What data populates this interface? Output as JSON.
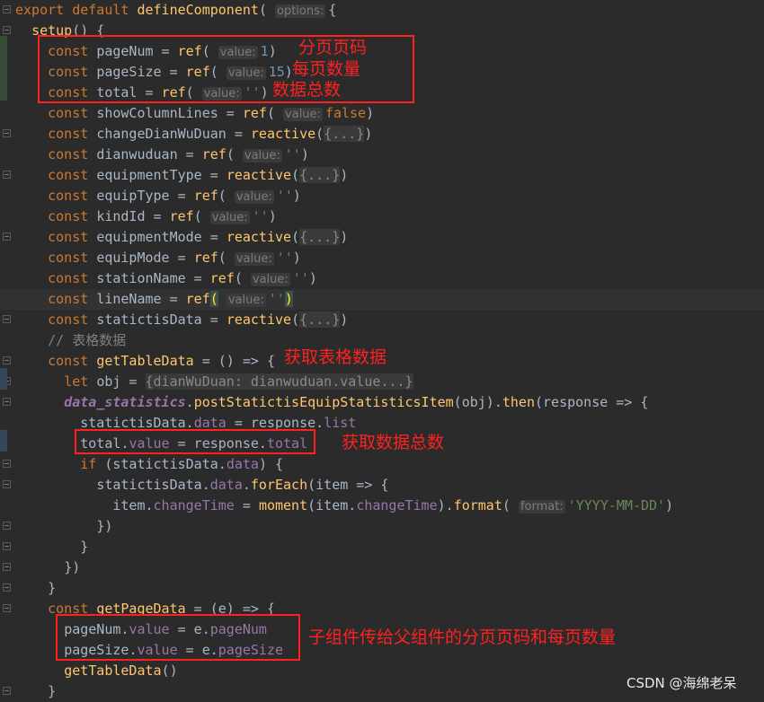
{
  "editor": {
    "lines": [
      {
        "indent": 0,
        "fold": true,
        "tokens": [
          [
            "k",
            "export default "
          ],
          [
            "f",
            "defineComponent"
          ],
          [
            "p",
            "( "
          ],
          [
            "h",
            "options:"
          ],
          [
            "p",
            "{"
          ]
        ]
      },
      {
        "indent": 1,
        "fold": true,
        "tokens": [
          [
            "f",
            "setup"
          ],
          [
            "p",
            "() {"
          ]
        ]
      },
      {
        "indent": 2,
        "tokens": [
          [
            "k",
            "const "
          ],
          [
            "p",
            "pageNum = "
          ],
          [
            "f",
            "ref"
          ],
          [
            "p",
            "( "
          ],
          [
            "h",
            "value:"
          ],
          [
            "n",
            "1"
          ],
          [
            "p",
            ")"
          ]
        ]
      },
      {
        "indent": 2,
        "tokens": [
          [
            "k",
            "const "
          ],
          [
            "p",
            "pageSize = "
          ],
          [
            "f",
            "ref"
          ],
          [
            "p",
            "( "
          ],
          [
            "h",
            "value:"
          ],
          [
            "n",
            "15"
          ],
          [
            "p",
            ")"
          ]
        ]
      },
      {
        "indent": 2,
        "tokens": [
          [
            "k",
            "const "
          ],
          [
            "p",
            "total = "
          ],
          [
            "f",
            "ref"
          ],
          [
            "p",
            "( "
          ],
          [
            "h",
            "value:"
          ],
          [
            "s",
            "''"
          ],
          [
            "p",
            ")"
          ]
        ]
      },
      {
        "indent": 2,
        "tokens": [
          [
            "k",
            "const "
          ],
          [
            "p",
            "showColumnLines = "
          ],
          [
            "f",
            "ref"
          ],
          [
            "p",
            "( "
          ],
          [
            "h",
            "value:"
          ],
          [
            "k",
            "false"
          ],
          [
            "p",
            ")"
          ]
        ]
      },
      {
        "indent": 2,
        "fold": true,
        "tokens": [
          [
            "k",
            "const "
          ],
          [
            "p",
            "changeDianWuDuan = "
          ],
          [
            "f",
            "reactive"
          ],
          [
            "p",
            "("
          ],
          [
            "fd",
            "{...}"
          ],
          [
            "p",
            ")"
          ]
        ]
      },
      {
        "indent": 2,
        "tokens": [
          [
            "k",
            "const "
          ],
          [
            "p",
            "dianwuduan = "
          ],
          [
            "f",
            "ref"
          ],
          [
            "p",
            "( "
          ],
          [
            "h",
            "value:"
          ],
          [
            "s",
            "''"
          ],
          [
            "p",
            ")"
          ]
        ]
      },
      {
        "indent": 2,
        "fold": true,
        "tokens": [
          [
            "k",
            "const "
          ],
          [
            "p",
            "equipmentType = "
          ],
          [
            "f",
            "reactive"
          ],
          [
            "p",
            "("
          ],
          [
            "fd",
            "{...}"
          ],
          [
            "p",
            ")"
          ]
        ]
      },
      {
        "indent": 2,
        "tokens": [
          [
            "k",
            "const "
          ],
          [
            "p",
            "equipType = "
          ],
          [
            "f",
            "ref"
          ],
          [
            "p",
            "( "
          ],
          [
            "h",
            "value:"
          ],
          [
            "s",
            "''"
          ],
          [
            "p",
            ")"
          ]
        ]
      },
      {
        "indent": 2,
        "tokens": [
          [
            "k",
            "const "
          ],
          [
            "p",
            "kindId = "
          ],
          [
            "f",
            "ref"
          ],
          [
            "p",
            "( "
          ],
          [
            "h",
            "value:"
          ],
          [
            "s",
            "''"
          ],
          [
            "p",
            ")"
          ]
        ]
      },
      {
        "indent": 2,
        "fold": true,
        "tokens": [
          [
            "k",
            "const "
          ],
          [
            "p",
            "equipmentMode = "
          ],
          [
            "f",
            "reactive"
          ],
          [
            "p",
            "("
          ],
          [
            "fd",
            "{...}"
          ],
          [
            "p",
            ")"
          ]
        ]
      },
      {
        "indent": 2,
        "tokens": [
          [
            "k",
            "const "
          ],
          [
            "p",
            "equipMode = "
          ],
          [
            "f",
            "ref"
          ],
          [
            "p",
            "( "
          ],
          [
            "h",
            "value:"
          ],
          [
            "s",
            "''"
          ],
          [
            "p",
            ")"
          ]
        ]
      },
      {
        "indent": 2,
        "tokens": [
          [
            "k",
            "const "
          ],
          [
            "p",
            "stationName = "
          ],
          [
            "f",
            "ref"
          ],
          [
            "p",
            "( "
          ],
          [
            "h",
            "value:"
          ],
          [
            "s",
            "''"
          ],
          [
            "p",
            ")"
          ]
        ]
      },
      {
        "indent": 2,
        "current": true,
        "tokens": [
          [
            "k",
            "const "
          ],
          [
            "p",
            "lineName = "
          ],
          [
            "f",
            "ref"
          ],
          [
            "bm",
            "("
          ],
          [
            "p",
            " "
          ],
          [
            "h",
            "value:"
          ],
          [
            "s",
            "''"
          ],
          [
            "bm",
            ")"
          ]
        ]
      },
      {
        "indent": 2,
        "fold": true,
        "tokens": [
          [
            "k",
            "const "
          ],
          [
            "p",
            "statictisData = "
          ],
          [
            "f",
            "reactive"
          ],
          [
            "p",
            "("
          ],
          [
            "fd",
            "{...}"
          ],
          [
            "p",
            ")"
          ]
        ]
      },
      {
        "indent": 2,
        "tokens": [
          [
            "c",
            "// 表格数据"
          ]
        ]
      },
      {
        "indent": 2,
        "fold": true,
        "tokens": [
          [
            "k",
            "const "
          ],
          [
            "f",
            "getTableData"
          ],
          [
            "p",
            " = () => {"
          ]
        ]
      },
      {
        "indent": 3,
        "fold": true,
        "tokens": [
          [
            "k",
            "let "
          ],
          [
            "p",
            "obj = "
          ],
          [
            "fd",
            "{dianWuDuan: dianwuduan.value...}"
          ]
        ]
      },
      {
        "indent": 3,
        "fold": true,
        "tokens": [
          [
            "g",
            "data_statistics"
          ],
          [
            "p",
            "."
          ],
          [
            "f",
            "postStatictisEquipStatisticsItem"
          ],
          [
            "p",
            "(obj)."
          ],
          [
            "f",
            "then"
          ],
          [
            "p",
            "(response => {"
          ]
        ]
      },
      {
        "indent": 4,
        "tokens": [
          [
            "p",
            "statictisData."
          ],
          [
            "m",
            "data"
          ],
          [
            "p",
            " = response."
          ],
          [
            "m",
            "list"
          ]
        ]
      },
      {
        "indent": 4,
        "tokens": [
          [
            "p",
            "total."
          ],
          [
            "m",
            "value"
          ],
          [
            "p",
            " = response."
          ],
          [
            "m",
            "total"
          ]
        ]
      },
      {
        "indent": 4,
        "fold": true,
        "tokens": [
          [
            "k",
            "if "
          ],
          [
            "p",
            "(statictisData."
          ],
          [
            "m",
            "data"
          ],
          [
            "p",
            ") {"
          ]
        ]
      },
      {
        "indent": 5,
        "fold": true,
        "tokens": [
          [
            "p",
            "statictisData."
          ],
          [
            "m",
            "data"
          ],
          [
            "p",
            "."
          ],
          [
            "f",
            "forEach"
          ],
          [
            "p",
            "(item => {"
          ]
        ]
      },
      {
        "indent": 6,
        "tokens": [
          [
            "p",
            "item."
          ],
          [
            "m",
            "changeTime"
          ],
          [
            "p",
            " = "
          ],
          [
            "f",
            "moment"
          ],
          [
            "p",
            "(item."
          ],
          [
            "m",
            "changeTime"
          ],
          [
            "p",
            ")."
          ],
          [
            "f",
            "format"
          ],
          [
            "p",
            "( "
          ],
          [
            "h",
            "format:"
          ],
          [
            "s",
            "'YYYY-MM-DD'"
          ],
          [
            "p",
            ")"
          ]
        ]
      },
      {
        "indent": 5,
        "fold": true,
        "tokens": [
          [
            "p",
            "})"
          ]
        ]
      },
      {
        "indent": 4,
        "fold": true,
        "tokens": [
          [
            "p",
            "}"
          ]
        ]
      },
      {
        "indent": 3,
        "fold": true,
        "tokens": [
          [
            "p",
            "})"
          ]
        ]
      },
      {
        "indent": 2,
        "fold": true,
        "tokens": [
          [
            "p",
            "}"
          ]
        ]
      },
      {
        "indent": 2,
        "fold": true,
        "tokens": [
          [
            "k",
            "const "
          ],
          [
            "f",
            "getPageData"
          ],
          [
            "p",
            " = (e) => {"
          ]
        ]
      },
      {
        "indent": 3,
        "tokens": [
          [
            "p",
            "pageNum."
          ],
          [
            "m",
            "value"
          ],
          [
            "p",
            " = e."
          ],
          [
            "m",
            "pageNum"
          ]
        ]
      },
      {
        "indent": 3,
        "tokens": [
          [
            "p",
            "pageSize."
          ],
          [
            "m",
            "value"
          ],
          [
            "p",
            " = e."
          ],
          [
            "m",
            "pageSize"
          ]
        ]
      },
      {
        "indent": 3,
        "tokens": [
          [
            "f",
            "getTableData"
          ],
          [
            "p",
            "()"
          ]
        ]
      },
      {
        "indent": 2,
        "fold": true,
        "tokens": [
          [
            "p",
            "}"
          ]
        ]
      }
    ]
  },
  "annotations": {
    "page_num": "分页页码",
    "page_size": "每页数量",
    "total": "数据总数",
    "get_table_data": "获取表格数据",
    "get_total": "获取数据总数",
    "child_to_parent": "子组件传给父组件的分页页码和每页数量"
  },
  "watermark": "CSDN @海绵老呆",
  "colors": {
    "background": "#2b2b2b",
    "keyword": "#cc7832",
    "function": "#ffc66d",
    "text": "#a9b7c6",
    "string": "#6a8759",
    "number": "#6897bb",
    "member": "#9876aa",
    "annotation": "#ff2020"
  }
}
